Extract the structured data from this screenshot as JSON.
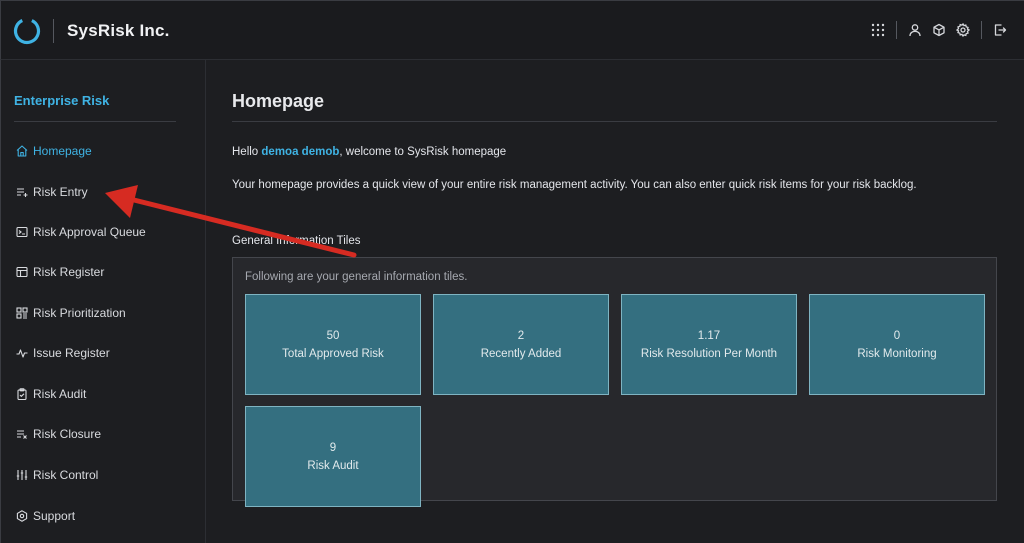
{
  "header": {
    "brand": "SysRisk Inc.",
    "icons": [
      "apps-grid-icon",
      "user-icon",
      "cube-icon",
      "gear-icon",
      "logout-icon"
    ]
  },
  "sidebar": {
    "title": "Enterprise Risk",
    "items": [
      {
        "label": "Homepage",
        "icon": "home-icon",
        "active": true
      },
      {
        "label": "Risk Entry",
        "icon": "list-add-icon"
      },
      {
        "label": "Risk Approval Queue",
        "icon": "terminal-icon"
      },
      {
        "label": "Risk Register",
        "icon": "table-icon"
      },
      {
        "label": "Risk Prioritization",
        "icon": "grid-icon"
      },
      {
        "label": "Issue Register",
        "icon": "pulse-icon"
      },
      {
        "label": "Risk Audit",
        "icon": "clipboard-icon"
      },
      {
        "label": "Risk Closure",
        "icon": "list-close-icon"
      },
      {
        "label": "Risk Control",
        "icon": "sliders-icon"
      },
      {
        "label": "Support",
        "icon": "hexagon-icon"
      }
    ]
  },
  "main": {
    "title": "Homepage",
    "greeting_prefix": "Hello ",
    "user_name": "demoa demob",
    "greeting_suffix": ", welcome to SysRisk homepage",
    "description": "Your homepage provides a quick view of your entire risk management activity. You can also enter quick risk items for your risk backlog.",
    "tiles_label": "General Information Tiles",
    "tiles_caption": "Following are your general information tiles.",
    "tiles": [
      {
        "value": "50",
        "label": "Total Approved Risk"
      },
      {
        "value": "2",
        "label": "Recently Added"
      },
      {
        "value": "1.17",
        "label": "Risk Resolution Per Month"
      },
      {
        "value": "0",
        "label": "Risk Monitoring"
      },
      {
        "value": "9",
        "label": "Risk Audit"
      }
    ]
  },
  "colors": {
    "accent": "#3fb3e4",
    "tile": "#346f80",
    "annotation_arrow": "#d62b22"
  }
}
